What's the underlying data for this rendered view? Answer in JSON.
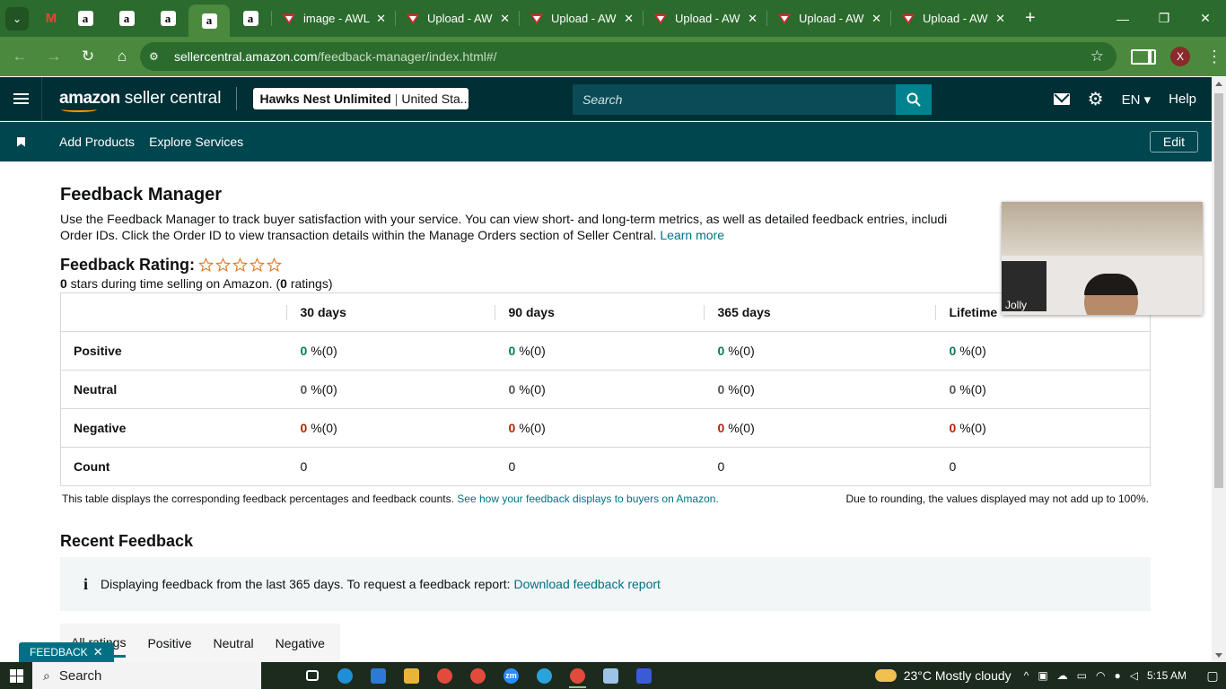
{
  "browser": {
    "tabs": [
      {
        "label": "image - AWL"
      },
      {
        "label": "Upload - AW"
      },
      {
        "label": "Upload - AW"
      },
      {
        "label": "Upload - AW"
      },
      {
        "label": "Upload - AW"
      },
      {
        "label": "Upload - AW"
      }
    ],
    "pinned": [
      "M",
      "a",
      "a",
      "a",
      "a",
      "a"
    ],
    "url_host": "sellercentral.amazon.com",
    "url_path": "/feedback-manager/index.html#/",
    "profile_initial": "X"
  },
  "header": {
    "logo_amazon": "amazon",
    "logo_sc": "seller central",
    "store_name": "Hawks Nest Unlimited",
    "store_region": "United Sta...",
    "search_placeholder": "Search",
    "language": "EN",
    "help": "Help"
  },
  "subnav": {
    "items": [
      "Add Products",
      "Explore Services"
    ],
    "edit": "Edit"
  },
  "page": {
    "title": "Feedback Manager",
    "desc_line1": "Use the Feedback Manager to track buyer satisfaction with your service. You can view short- and long-term metrics, as well as detailed feedback entries, includi",
    "desc_line2_prefix": "Order IDs. Click the Order ID to view transaction details within the Manage Orders section of Seller Central. ",
    "learn_more": "Learn more",
    "rating_label": "Feedback Rating:",
    "rating_stars": 0,
    "rating_sub_stars": "0",
    "rating_sub_mid": " stars during time selling on Amazon. (",
    "rating_sub_count": "0",
    "rating_sub_end": " ratings)"
  },
  "table": {
    "columns": [
      "30 days",
      "90 days",
      "365 days",
      "Lifetime"
    ],
    "rows": [
      {
        "label": "Positive",
        "values": [
          "0",
          "0",
          "0",
          "0"
        ],
        "counts": [
          "%(0)",
          "%(0)",
          "%(0)",
          "%(0)"
        ]
      },
      {
        "label": "Neutral",
        "values": [
          "0",
          "0",
          "0",
          "0"
        ],
        "counts": [
          "%(0)",
          "%(0)",
          "%(0)",
          "%(0)"
        ]
      },
      {
        "label": "Negative",
        "values": [
          "0",
          "0",
          "0",
          "0"
        ],
        "counts": [
          "%(0)",
          "%(0)",
          "%(0)",
          "%(0)"
        ]
      },
      {
        "label": "Count",
        "values": [
          "0",
          "0",
          "0",
          "0"
        ]
      }
    ],
    "note_left": "This table displays the corresponding feedback percentages and feedback counts. ",
    "note_link": "See how your feedback displays to buyers on Amazon.",
    "note_right": "Due to rounding, the values displayed may not add up to 100%."
  },
  "recent": {
    "title": "Recent Feedback",
    "info_text": "Displaying feedback from the last 365 days. To request a feedback report: ",
    "info_link": "Download feedback report",
    "tabs": [
      "All ratings",
      "Positive",
      "Neutral",
      "Negative"
    ]
  },
  "feedback_pill": "FEEDBACK",
  "video": {
    "name": "Jolly"
  },
  "taskbar": {
    "search": "Search",
    "weather": "23°C  Mostly cloudy",
    "time": "5:15 AM"
  },
  "colors": {
    "header": "#002f36",
    "subnav": "#00464f",
    "link": "#007185",
    "positive": "#067d62",
    "negative": "#b12704",
    "chrome": "#2b6b2d"
  }
}
